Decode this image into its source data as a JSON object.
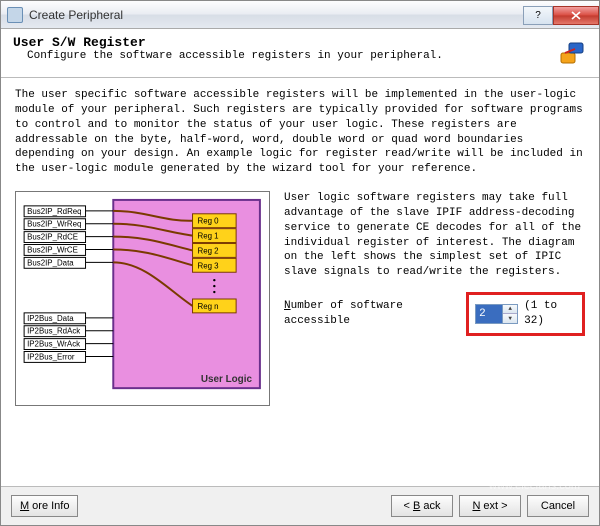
{
  "window": {
    "title": "Create Peripheral"
  },
  "header": {
    "title": "User S/W Register",
    "subtitle": "Configure the software accessible registers in your peripheral."
  },
  "content": {
    "intro": "The user specific software accessible registers will be implemented in the user-logic module of your peripheral. Such registers are typically provided for software programs to control and to monitor the status of your user logic. These registers are addressable on the byte, half-word, word, double word or quad word boundaries depending on your design. An example logic for register read/write will be included in the user-logic module generated by the wizard tool for your reference.",
    "right_desc": "User logic software registers may take full advantage of the slave IPIF address-decoding service to generate CE decodes for all of the individual register of interest. The diagram on the left shows the simplest set of IPIC slave signals to read/write the registers.",
    "field_label": "Number of software accessible",
    "spinner_value": "2",
    "range_text": "(1 to 32)"
  },
  "diagram": {
    "signals_top": [
      "Bus2IP_RdReq",
      "Bus2IP_WrReq",
      "Bus2IP_RdCE",
      "Bus2IP_WrCE",
      "Bus2IP_Data"
    ],
    "signals_bottom": [
      "IP2Bus_Data",
      "IP2Bus_RdAck",
      "IP2Bus_WrAck",
      "IP2Bus_Error"
    ],
    "regs": [
      "Reg 0",
      "Reg 1",
      "Reg 2",
      "Reg 3",
      "Reg n"
    ],
    "block_label": "User Logic"
  },
  "footer": {
    "more_info": "More Info",
    "back": "Back",
    "next": "Next",
    "cancel": "Cancel"
  },
  "watermark": "www.elecfans.com"
}
